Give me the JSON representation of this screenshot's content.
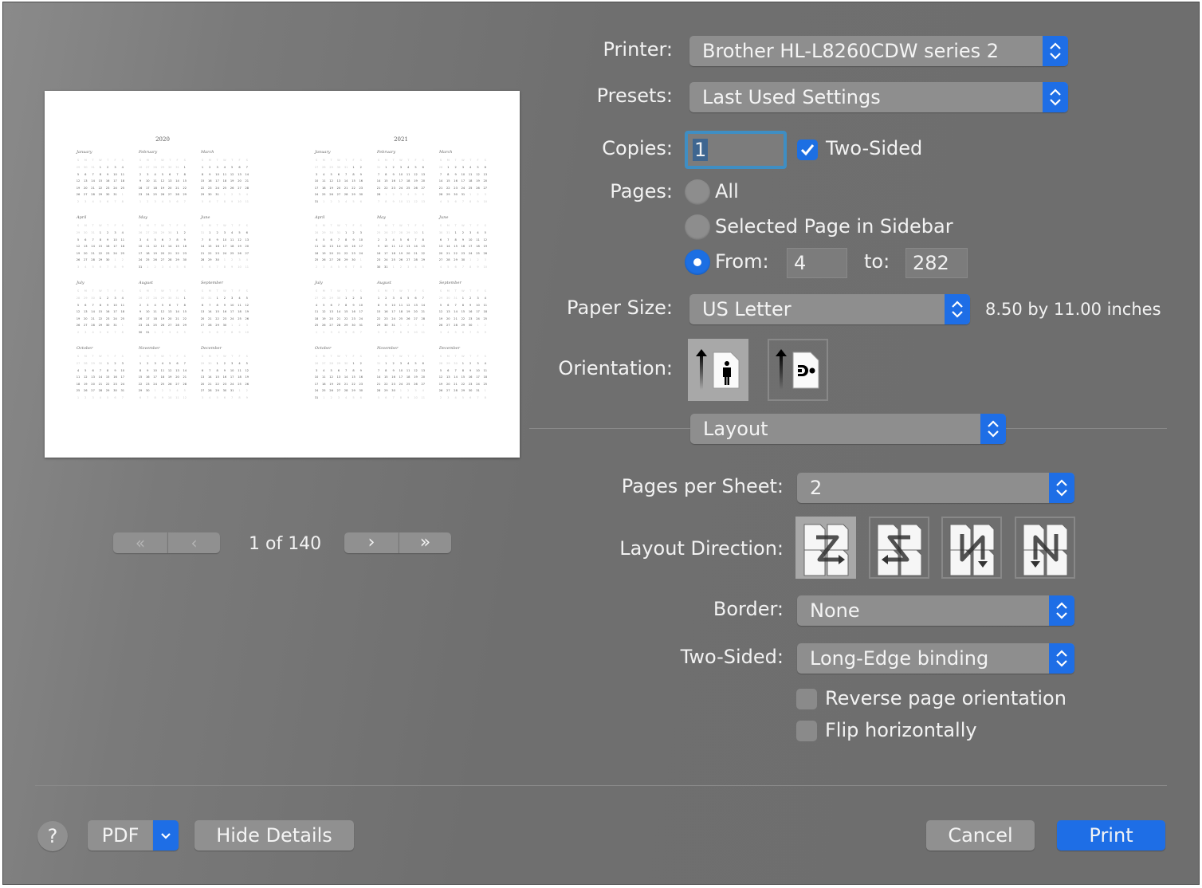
{
  "printer": {
    "label": "Printer:",
    "value": "Brother HL-L8260CDW series 2"
  },
  "presets": {
    "label": "Presets:",
    "value": "Last Used Settings"
  },
  "copies": {
    "label": "Copies:",
    "value": "1",
    "two_sided_label": "Two-Sided",
    "two_sided_checked": true
  },
  "pages": {
    "label": "Pages:",
    "options": [
      "All",
      "Selected Page in Sidebar"
    ],
    "from_label": "From:",
    "from": "4",
    "to_label": "to:",
    "to": "282",
    "selected": "From"
  },
  "paper_size": {
    "label": "Paper Size:",
    "value": "US Letter",
    "dimensions": "8.50 by 11.00 inches"
  },
  "orientation": {
    "label": "Orientation:",
    "selected": "portrait"
  },
  "section": {
    "value": "Layout"
  },
  "layout": {
    "pages_per_sheet": {
      "label": "Pages per Sheet:",
      "value": "2"
    },
    "direction": {
      "label": "Layout Direction:",
      "selected": "z-right"
    },
    "border": {
      "label": "Border:",
      "value": "None"
    },
    "two_sided": {
      "label": "Two-Sided:",
      "value": "Long-Edge binding"
    },
    "reverse": {
      "label": "Reverse page orientation",
      "checked": false
    },
    "flip": {
      "label": "Flip horizontally",
      "checked": false
    }
  },
  "preview": {
    "pager": "1 of 140",
    "years": [
      "2020",
      "2021"
    ],
    "months": [
      "January",
      "February",
      "March",
      "April",
      "May",
      "June",
      "July",
      "August",
      "September",
      "October",
      "November",
      "December"
    ],
    "weekdays": [
      "S",
      "M",
      "T",
      "W",
      "T",
      "F",
      "S"
    ]
  },
  "footer": {
    "help": "?",
    "pdf": "PDF",
    "hide_details": "Hide Details",
    "cancel": "Cancel",
    "print": "Print"
  },
  "colors": {
    "accent": "#1e6ee6"
  }
}
